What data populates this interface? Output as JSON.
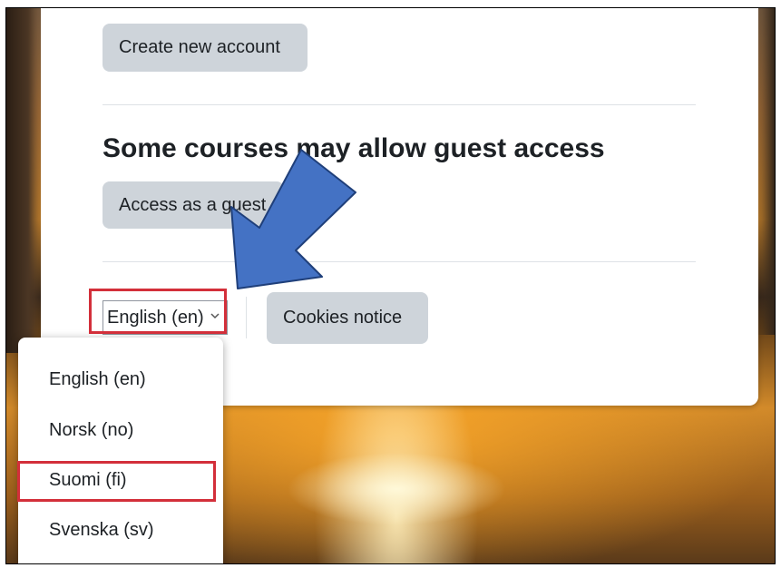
{
  "login": {
    "create_account_label": "Create new account",
    "guest_heading": "Some courses may allow guest access",
    "guest_button_label": "Access as a guest"
  },
  "footer": {
    "language_selected": "English (en)",
    "cookies_label": "Cookies notice"
  },
  "language_menu": {
    "options": [
      "English (en)",
      "Norsk (no)",
      "Suomi (fi)",
      "Svenska (sv)"
    ],
    "highlighted": "Suomi (fi)"
  },
  "annotation": {
    "arrow_color": "#4472c4",
    "highlight_color": "#d32f3a"
  }
}
